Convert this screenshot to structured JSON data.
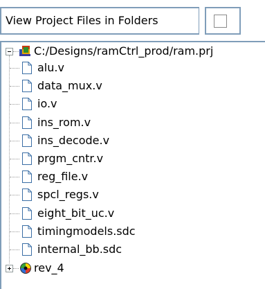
{
  "option": {
    "label": "View Project Files in Folders",
    "checked": false
  },
  "tree": {
    "project_path": "C:/Designs/ramCtrl_prod/ram.prj",
    "files": [
      "alu.v",
      "data_mux.v",
      "io.v",
      "ins_rom.v",
      "ins_decode.v",
      "prgm_cntr.v",
      "reg_file.v",
      "spcl_regs.v",
      "eight_bit_uc.v",
      "timingmodels.sdc",
      "internal_bb.sdc"
    ],
    "implementation": "rev_4",
    "colors": {
      "border": "#7f9db9",
      "file_icon_fill": "#ffffff",
      "file_icon_stroke": "#3a6ea5"
    }
  }
}
